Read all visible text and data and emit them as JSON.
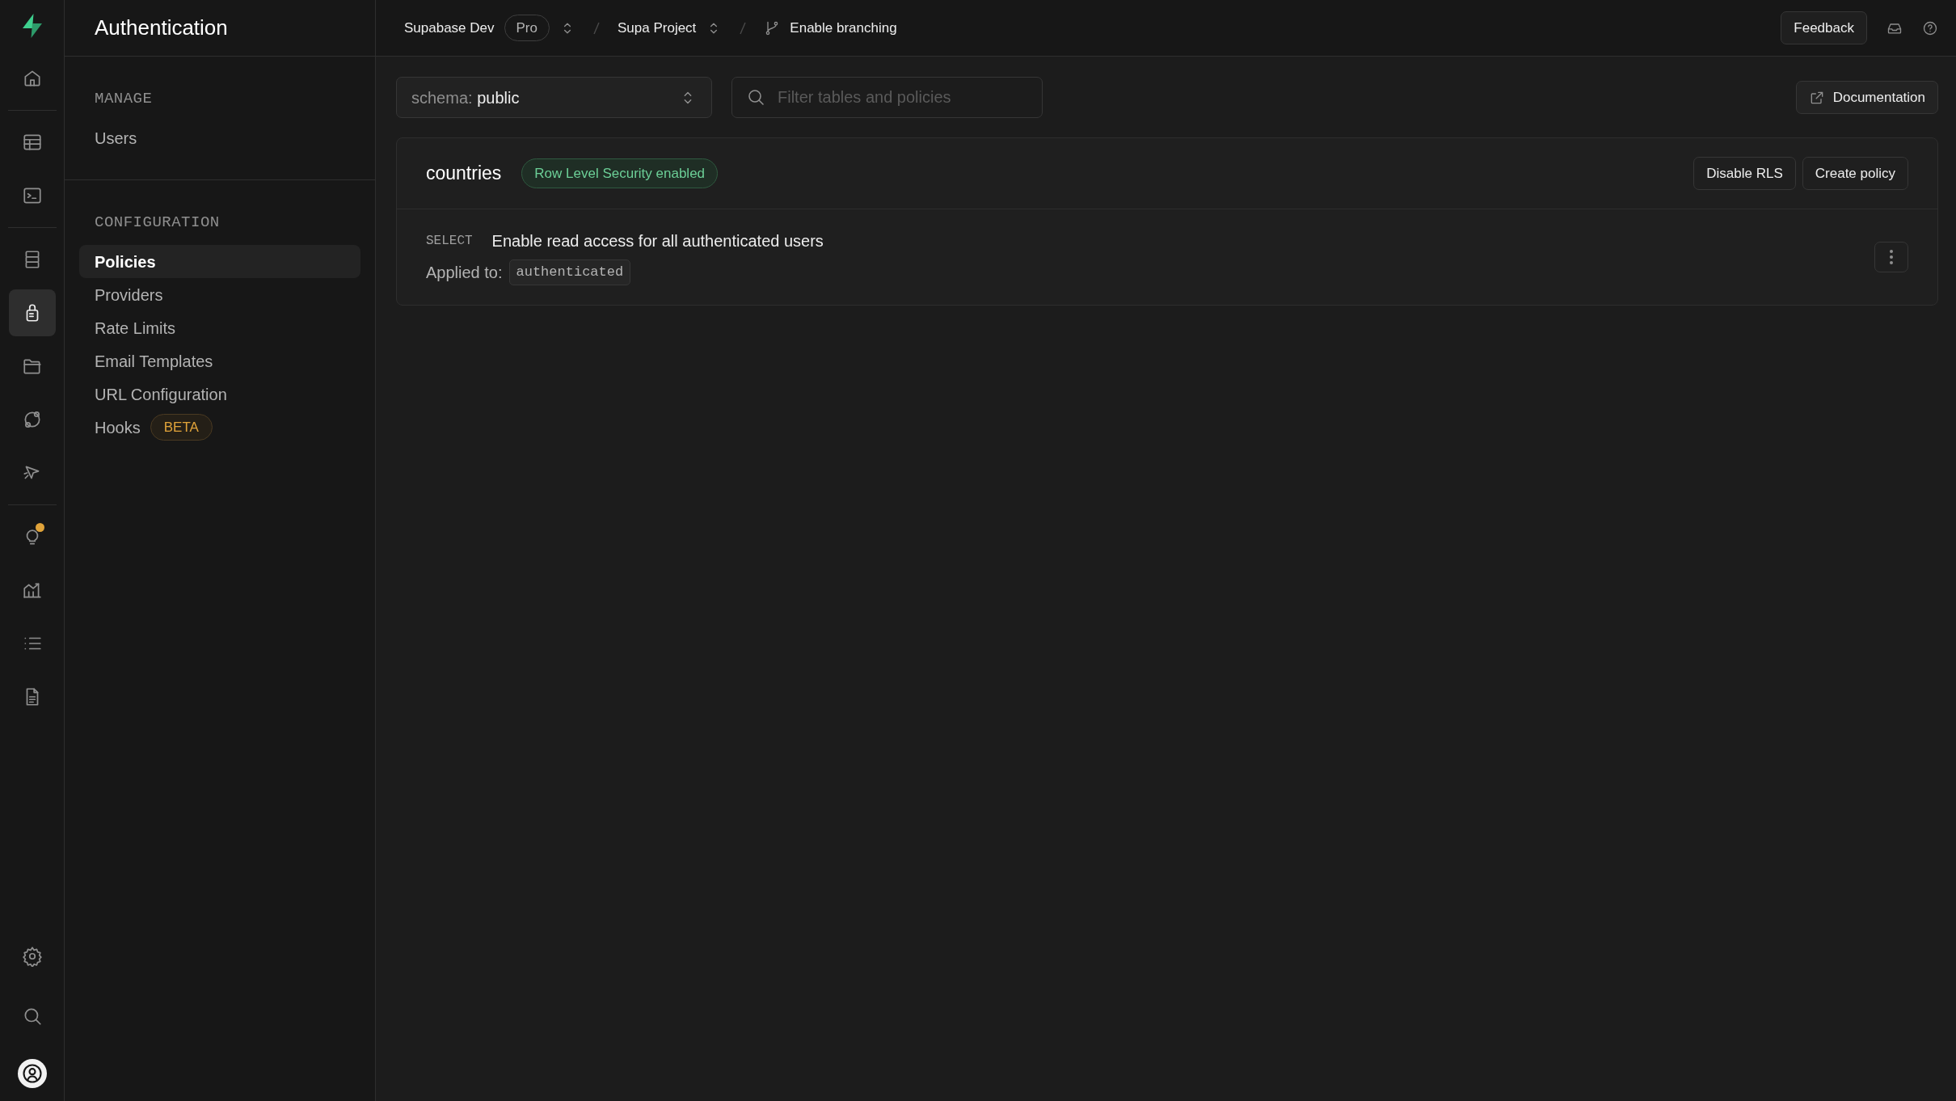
{
  "rail": {
    "groups": [
      {
        "items": [
          {
            "selected": false,
            "notification": false
          }
        ]
      },
      {
        "items": [
          {
            "selected": false,
            "notification": false
          },
          {
            "selected": false,
            "notification": false
          }
        ]
      },
      {
        "items": [
          {
            "selected": false,
            "notification": false
          },
          {
            "selected": true,
            "notification": false
          },
          {
            "selected": false,
            "notification": false
          },
          {
            "selected": false,
            "notification": false
          },
          {
            "selected": false,
            "notification": false
          }
        ]
      },
      {
        "items": [
          {
            "selected": false,
            "notification": true
          },
          {
            "selected": false,
            "notification": false
          },
          {
            "selected": false,
            "notification": false
          },
          {
            "selected": false,
            "notification": false
          }
        ]
      }
    ]
  },
  "sidebar": {
    "title": "Authentication",
    "sections": [
      {
        "heading": "MANAGE",
        "items": [
          {
            "label": "Users",
            "selected": false
          }
        ]
      },
      {
        "heading": "CONFIGURATION",
        "items": [
          {
            "label": "Policies",
            "selected": true
          },
          {
            "label": "Providers",
            "selected": false
          },
          {
            "label": "Rate Limits",
            "selected": false
          },
          {
            "label": "Email Templates",
            "selected": false
          },
          {
            "label": "URL Configuration",
            "selected": false
          },
          {
            "label": "Hooks",
            "selected": false,
            "badge": "BETA"
          }
        ]
      }
    ]
  },
  "top_bar": {
    "organization": "Supabase Dev",
    "plan": "Pro",
    "project": "Supa Project",
    "branch": "Enable branching",
    "feedback": "Feedback"
  },
  "toolbar": {
    "schema_label": "schema:",
    "schema_value": "public",
    "search": {
      "placeholder": "Filter tables and policies"
    },
    "documentation": "Documentation"
  },
  "tables": [
    {
      "name": "countries",
      "rls_badge": "Row Level Security enabled",
      "buttons": [
        "Disable RLS",
        "Create policy"
      ],
      "policies": [
        {
          "command": "SELECT",
          "name": "Enable read access for all authenticated users",
          "applied_label": "Applied to:",
          "roles": [
            "authenticated"
          ]
        }
      ]
    }
  ]
}
